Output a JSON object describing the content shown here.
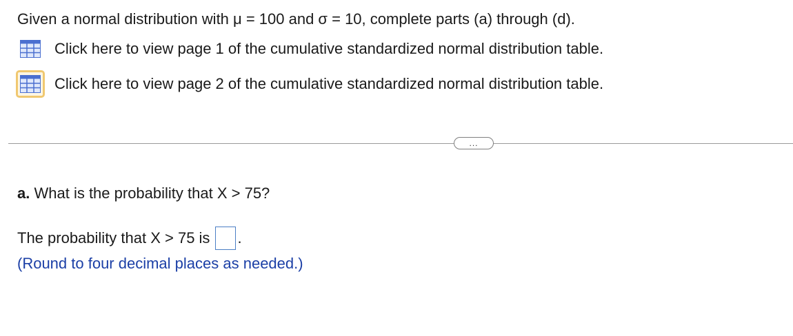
{
  "question": {
    "header": "Given a normal distribution with μ = 100 and σ = 10, complete parts (a) through (d)."
  },
  "table_links": [
    {
      "label": "Click here to view page 1 of the cumulative standardized normal distribution table.",
      "icon": "table-icon"
    },
    {
      "label": "Click here to view page 2 of the cumulative standardized normal distribution table.",
      "icon": "table-icon"
    }
  ],
  "divider": {
    "more_label": "..."
  },
  "part_a": {
    "letter": "a.",
    "question": "What is the probability that X > 75?",
    "answer_prefix": "The probability that X > 75 is",
    "answer_value": "",
    "answer_suffix": ".",
    "instruction": "(Round to four decimal places as needed.)"
  },
  "colors": {
    "instruction_text": "#1b3fa6",
    "icon_blue": "#4a6fd0",
    "focus_highlight": "#f0c870",
    "answer_box_border": "#4a7ec4"
  }
}
